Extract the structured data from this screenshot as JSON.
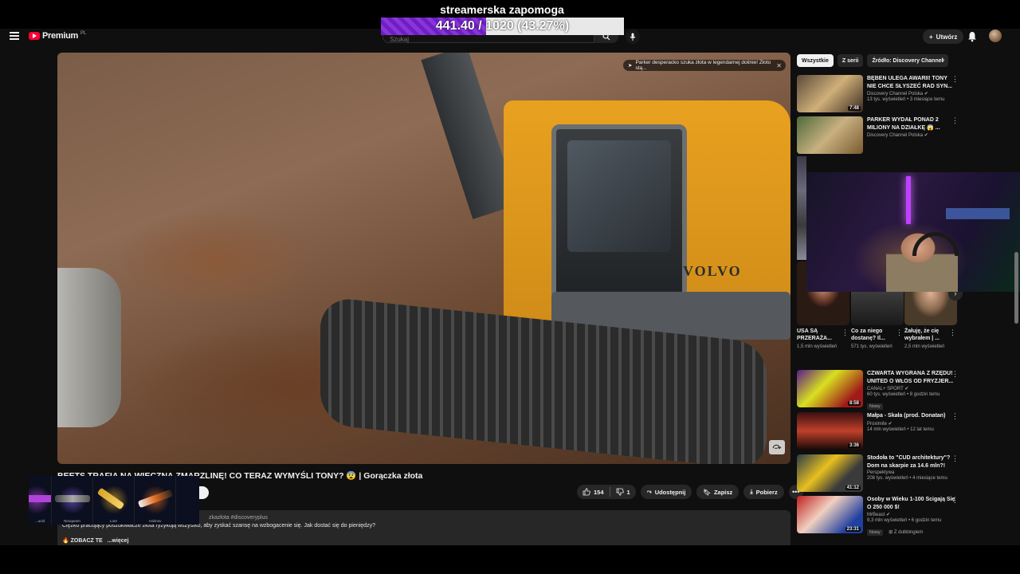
{
  "overlay": {
    "stream_title": "streamerska zapomoga",
    "goal_text": "441.40 / 1020 (43.27%)",
    "goal_fraction": 0.4327
  },
  "masthead": {
    "logo_text": "Premium",
    "logo_country": "PL",
    "search_placeholder": "Szukaj",
    "create_label": "Utwórz"
  },
  "video": {
    "chip_text": "Parker desperacko szuka złota w legendarnej dolinie! Złoto stą...",
    "brand": "VOLVO",
    "title": "BEETS TRAFIA NA WIECZNĄ ZMARZLINĘ! CO TERAZ WYMYŚLI TONY? 😨 | Gorączka złota",
    "likes": "154",
    "dislikes": "1",
    "share_label": "Udostępnij",
    "save_label": "Zapisz",
    "download_label": "Pobierz"
  },
  "description": {
    "hashtags": "zkazłota #discoveryplus",
    "line1": "Ciężko pracujący poszukiwacze złota ryzykują wszystko, aby zyskać szansę na wzbogacenie się. Jak dostać się do pieniędzy?",
    "line2_prefix": "🔥 ZOBACZ TE",
    "more_label": "...więcej"
  },
  "chips": [
    "Wszystkie",
    "Z serii",
    "Źródło: Discovery Channel"
  ],
  "recommendations": [
    {
      "title": "BĘBEN ULEGA AWARII! TONY NIE CHCE SŁYSZEĆ RAD SYN...",
      "channel": "Discovery Channel Polska ✔",
      "meta": "13 tys. wyświetleń • 3 miesiące temu",
      "duration": "7:48",
      "badge": ""
    },
    {
      "title": "PARKER WYDAŁ PONAD 2 MILIONY NA DZIAŁKĘ 😱 ...",
      "channel": "Discovery Channel Polska ✔",
      "meta": "",
      "duration": "",
      "badge": ""
    },
    {
      "title": "CZWARTA WYGRANA Z RZĘDU! UNITED O WŁOS OD FRYZJER...",
      "channel": "CANAL+ SPORT ✔",
      "meta": "60 tys. wyświetleń • 8 godzin temu",
      "duration": "8:58",
      "badge": "Nowy"
    },
    {
      "title": "Małpa - Skała (prod. Donatan)",
      "channel": "Proximite ✔",
      "meta": "14 mln wyświetleń • 12 lat temu",
      "duration": "3:36",
      "badge": ""
    },
    {
      "title": "Stodoła to \"CUD architektury\"? Dom na skarpie za 14.6 mln?!",
      "channel": "Perspektywa",
      "meta": "208 tys. wyświetleń • 4 miesiące temu",
      "duration": "41:12",
      "badge": ""
    },
    {
      "title": "Osoby w Wieku 1-100 Ścigają Się O 250 000 $!",
      "channel": "MrBeast ✔",
      "meta": "9,3 mln wyświetleń • 6 godzin temu",
      "duration": "23:31",
      "badge": "Nowy",
      "extra": "⊞ Z dubbingiem"
    }
  ],
  "shorts": [
    {
      "title": "USA SĄ PRZERAŻA...",
      "views": "1,5 mln wyświetleń"
    },
    {
      "title": "Co za niego dostanę? Il...",
      "views": "571 tys. wyświetleń"
    },
    {
      "title": "Żałuję, że cię wybrałem | ...",
      "views": "2,5 mln wyświetleń"
    }
  ],
  "skins": [
    {
      "name": "...ucid",
      "color": "#b043d8"
    },
    {
      "name": "Neoqueen",
      "color": "#7b5cd6"
    },
    {
      "name": "Lore",
      "color": "#d9a325"
    },
    {
      "name": "Asiimov",
      "color": "#e06a1f"
    }
  ],
  "colors": {
    "goal_fill": "#7a27d0",
    "yt_background": "#0f0f0f",
    "logo_red": "#ff0033"
  }
}
